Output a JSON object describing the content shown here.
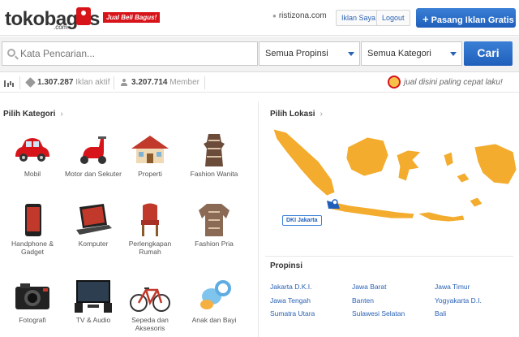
{
  "header": {
    "logo_text": "tokobagus",
    "logo_sub": ".com",
    "slogan": "Jual Beli Bagus!",
    "site": "ristizona.com",
    "iklan_saya": "Iklan Saya",
    "logout": "Logout",
    "pasang_plus": "+",
    "pasang": "Pasang Iklan Gratis"
  },
  "search": {
    "placeholder": "Kata Pencarian...",
    "province": "Semua Propinsi",
    "category": "Semua Kategori",
    "submit": "Cari"
  },
  "stats": {
    "ads_count": "1.307.287",
    "ads_label": "Iklan aktif",
    "member_count": "3.207.714",
    "member_label": "Member",
    "promo": "jual disini paling cepat laku!"
  },
  "categories": {
    "title": "Pilih Kategori",
    "items": [
      {
        "label": "Mobil"
      },
      {
        "label": "Motor dan Sekuter"
      },
      {
        "label": "Properti"
      },
      {
        "label": "Fashion Wanita"
      },
      {
        "label": "Handphone & Gadget"
      },
      {
        "label": "Komputer"
      },
      {
        "label": "Perlengkapan Rumah"
      },
      {
        "label": "Fashion Pria"
      },
      {
        "label": "Fotografi"
      },
      {
        "label": "TV & Audio"
      },
      {
        "label": "Sepeda dan Aksesoris"
      },
      {
        "label": "Anak dan Bayi"
      }
    ]
  },
  "location": {
    "title": "Pilih Lokasi",
    "map_label": "DKI Jakarta",
    "province_title": "Propinsi",
    "provinces": [
      "Jakarta D.K.I.",
      "Jawa Barat",
      "Jawa Timur",
      "Jawa Tengah",
      "Banten",
      "Yogyakarta D.I.",
      "Sumatra Utara",
      "Sulawesi Selatan",
      "Bali"
    ]
  },
  "colors": {
    "brand_red": "#d7141a",
    "accent_blue": "#1f5fbb",
    "map_orange": "#f3ac2d"
  }
}
